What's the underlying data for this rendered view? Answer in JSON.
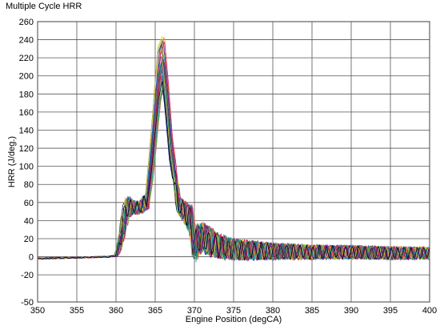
{
  "chart_data": {
    "type": "line",
    "title": "Multiple Cycle HRR",
    "xlabel": "Engine Position (degCA)",
    "ylabel": "HRR (J/deg.)",
    "xlim": [
      350,
      400
    ],
    "ylim": [
      -50,
      260
    ],
    "x_ticks": [
      350,
      355,
      360,
      365,
      370,
      375,
      380,
      385,
      390,
      395,
      400
    ],
    "y_ticks": [
      -50,
      -20,
      0,
      20,
      40,
      60,
      80,
      100,
      120,
      140,
      160,
      180,
      200,
      220,
      240,
      260
    ],
    "grid": true,
    "legend": "none",
    "cycle_count": 40,
    "envelope": {
      "x": [
        350,
        355,
        359,
        360,
        360.5,
        361,
        361.5,
        362,
        363,
        364,
        364.5,
        365,
        365.5,
        366,
        366.5,
        367,
        368,
        369,
        369.5,
        370,
        371,
        372,
        373,
        375,
        380,
        385,
        390,
        395,
        400
      ],
      "y_min": [
        -3,
        -2,
        -1,
        0,
        5,
        20,
        38,
        45,
        45,
        50,
        70,
        110,
        150,
        175,
        140,
        95,
        45,
        30,
        20,
        -10,
        0,
        -5,
        -5,
        -8,
        -5,
        -5,
        -5,
        -5,
        -5
      ],
      "y_max": [
        -1,
        0,
        1,
        2,
        25,
        60,
        70,
        65,
        62,
        75,
        125,
        180,
        235,
        245,
        195,
        135,
        70,
        60,
        62,
        40,
        40,
        35,
        30,
        22,
        18,
        15,
        14,
        13,
        12
      ]
    },
    "mean_trace": {
      "x": [
        350,
        355,
        359,
        360,
        360.5,
        361,
        361.5,
        362,
        363,
        364,
        364.5,
        365,
        365.5,
        366,
        366.5,
        367,
        368,
        369,
        369.5,
        370,
        371,
        372,
        373,
        375,
        380,
        385,
        390,
        395,
        400
      ],
      "y": [
        -2,
        -1,
        0,
        1,
        14,
        40,
        55,
        55,
        54,
        62,
        95,
        145,
        195,
        212,
        170,
        115,
        58,
        47,
        42,
        15,
        22,
        16,
        12,
        8,
        6,
        5,
        5,
        4,
        4
      ]
    }
  }
}
